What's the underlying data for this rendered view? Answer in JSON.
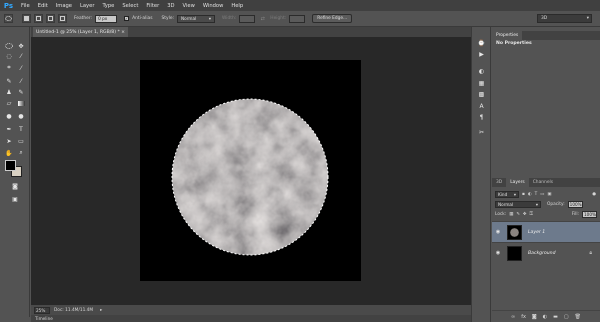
{
  "menubar": {
    "logo": "Ps",
    "items": [
      "File",
      "Edit",
      "Image",
      "Layer",
      "Type",
      "Select",
      "Filter",
      "3D",
      "View",
      "Window",
      "Help"
    ]
  },
  "options": {
    "feather_label": "Feather:",
    "feather_value": "0 px",
    "antialias_label": "Anti-alias",
    "style_label": "Style:",
    "style_value": "Normal",
    "width_label": "Width:",
    "height_label": "Height:",
    "refine_label": "Refine Edge...",
    "workspace_value": "3D"
  },
  "document": {
    "tab_title": "Untitled-1 @ 25% (Layer 1, RGB/8) *",
    "zoom": "25%",
    "doc_info": "Doc: 11.4M/11.4M"
  },
  "timeline": {
    "label": "Timeline"
  },
  "properties": {
    "tab_label": "Properties",
    "body_text": "No Properties"
  },
  "layers": {
    "tabs": [
      "3D",
      "Layers",
      "Channels"
    ],
    "kind_value": "Kind",
    "blend_value": "Normal",
    "opacity_label": "Opacity:",
    "opacity_value": "100%",
    "lock_label": "Lock:",
    "fill_label": "Fill:",
    "fill_value": "100%",
    "items": [
      {
        "name": "Layer 1",
        "selected": true
      },
      {
        "name": "Background",
        "selected": false
      }
    ]
  },
  "colors": {
    "foreground": "#000000",
    "background": "#d9d1c3",
    "accent": "#6d7a8c"
  },
  "icons": [
    "marquee-icon",
    "move-icon",
    "lasso-icon",
    "magic-wand-icon",
    "crop-icon",
    "eyedropper-icon",
    "healing-brush-icon",
    "brush-icon",
    "clone-stamp-icon",
    "history-brush-icon",
    "eraser-icon",
    "gradient-icon",
    "blur-icon",
    "dodge-icon",
    "pen-icon",
    "type-icon",
    "path-selection-icon",
    "shape-icon",
    "hand-icon",
    "zoom-icon"
  ]
}
